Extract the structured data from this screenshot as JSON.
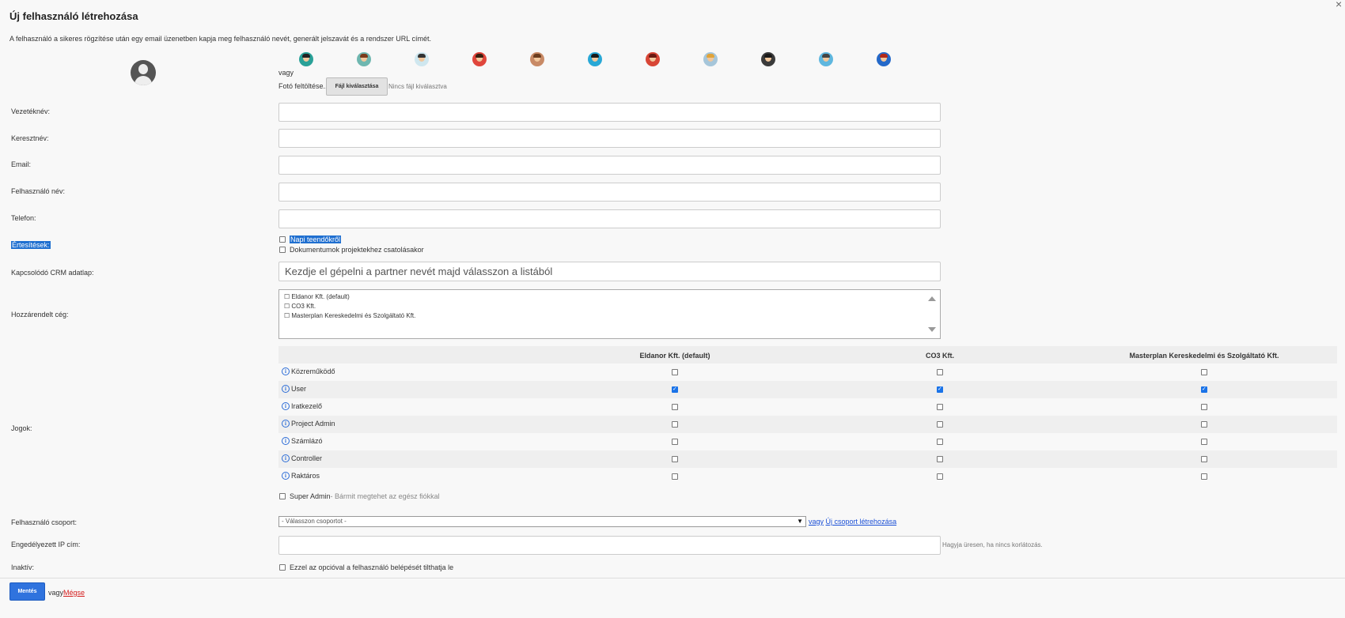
{
  "header": {
    "title": "Új felhasználó létrehozása",
    "close_label": "×"
  },
  "intro": "A felhasználó a sikeres rögzítése után egy email üzenetben kapja meg felhasználó nevét, generált jelszavát és a rendszer URL címét.",
  "avatars": [
    {
      "icon": "avatar-1-icon",
      "bg": "#2aa198",
      "hair": "#222"
    },
    {
      "icon": "avatar-2-icon",
      "bg": "#6fb7b0",
      "hair": "#7a3b1b"
    },
    {
      "icon": "avatar-3-icon",
      "bg": "#cfe7ef",
      "hair": "#333"
    },
    {
      "icon": "avatar-4-icon",
      "bg": "#e0463c",
      "hair": "#3a1e0e"
    },
    {
      "icon": "avatar-5-icon",
      "bg": "#c88a66",
      "hair": "#6b3d1f"
    },
    {
      "icon": "avatar-6-icon",
      "bg": "#29a8d6",
      "hair": "#1a1a1a"
    },
    {
      "icon": "avatar-7-icon",
      "bg": "#d84636",
      "hair": "#6a1a12"
    },
    {
      "icon": "avatar-8-icon",
      "bg": "#a6c6da",
      "hair": "#e0a33a"
    },
    {
      "icon": "avatar-9-icon",
      "bg": "#3b3b3b",
      "hair": "#1a1a1a"
    },
    {
      "icon": "avatar-10-icon",
      "bg": "#5fb7df",
      "hair": "#444"
    },
    {
      "icon": "avatar-11-icon",
      "bg": "#2469c9",
      "hair": "#b22a1a"
    }
  ],
  "photo": {
    "or": "vagy",
    "upload_label": "Fotó feltöltése...",
    "file_button": "Fájl kiválasztása",
    "no_file": "Nincs fájl kiválasztva"
  },
  "fields": {
    "lastname": {
      "label": "Vezetéknév:",
      "value": ""
    },
    "firstname": {
      "label": "Keresztnév:",
      "value": ""
    },
    "email": {
      "label": "Email:",
      "value": ""
    },
    "username": {
      "label": "Felhasználó név:",
      "value": ""
    },
    "phone": {
      "label": "Telefon:",
      "value": ""
    }
  },
  "notifications": {
    "label": "Értesítések:",
    "options": [
      {
        "label": "Napi teendőkről",
        "checked": false
      },
      {
        "label": "Dokumentumok projektekhez csatolásakor",
        "checked": false
      }
    ]
  },
  "crm": {
    "label": "Kapcsolódó CRM adatlap:",
    "placeholder": "Kezdje el gépelni a partner nevét majd válasszon a listából"
  },
  "company": {
    "label": "Hozzárendelt cég:",
    "options": [
      "☐ Eldanor Kft. (default)",
      "☐ CO3 Kft.",
      "☐ Masterplan Kereskedelmi és Szolgáltató Kft."
    ]
  },
  "permissions": {
    "label": "Jogok:",
    "columns": [
      "Eldanor Kft. (default)",
      "CO3 Kft.",
      "Masterplan Kereskedelmi és Szolgáltató Kft."
    ],
    "rows": [
      {
        "name": "Közreműködő",
        "checks": [
          false,
          false,
          false
        ]
      },
      {
        "name": "User",
        "checks": [
          true,
          true,
          true
        ]
      },
      {
        "name": "Iratkezelő",
        "checks": [
          false,
          false,
          false
        ]
      },
      {
        "name": "Project Admin",
        "checks": [
          false,
          false,
          false
        ]
      },
      {
        "name": "Számlázó",
        "checks": [
          false,
          false,
          false
        ]
      },
      {
        "name": "Controller",
        "checks": [
          false,
          false,
          false
        ]
      },
      {
        "name": "Raktáros",
        "checks": [
          false,
          false,
          false
        ]
      }
    ],
    "super_admin": {
      "label": "Super Admin",
      "desc": "- Bármit megtehet az egész fiókkal",
      "checked": false
    }
  },
  "group": {
    "label": "Felhasználó csoport:",
    "selected": "- Válasszon csoportot -",
    "arrow": "▼",
    "or": "vagy",
    "create_link": "Új csoport létrehozása"
  },
  "ip": {
    "label": "Engedélyezett IP cím:",
    "value": "",
    "hint": "Hagyja üresen, ha nincs korlátozás."
  },
  "inactive": {
    "label": "Inaktív:",
    "option": "Ezzel az opcióval a felhasználó belépését tilthatja le",
    "checked": false
  },
  "footer": {
    "save": "Mentés",
    "or": "vagy",
    "cancel": "Mégse"
  }
}
